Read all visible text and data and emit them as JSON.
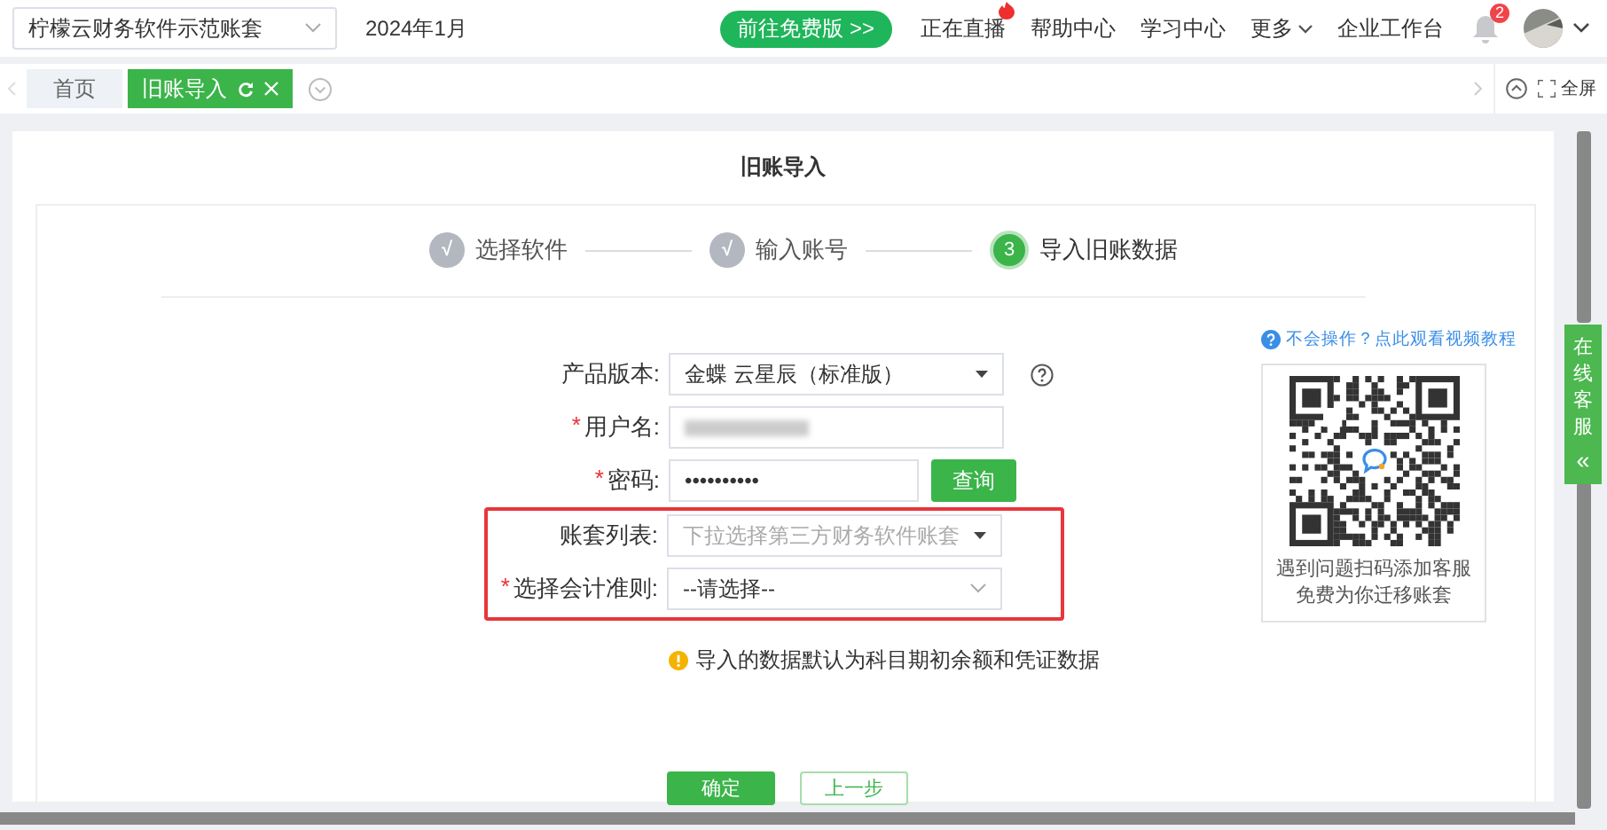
{
  "top_bar": {
    "account_selector": {
      "value": "柠檬云财务软件示范账套"
    },
    "period": "2024年1月",
    "promo_button": "前往免费版 >>",
    "nav_links": [
      {
        "label": "正在直播",
        "hot": true,
        "dropdown": false
      },
      {
        "label": "帮助中心",
        "hot": false,
        "dropdown": false
      },
      {
        "label": "学习中心",
        "hot": false,
        "dropdown": false
      },
      {
        "label": "更多",
        "hot": false,
        "dropdown": true
      },
      {
        "label": "企业工作台",
        "hot": false,
        "dropdown": false
      }
    ],
    "notifications": {
      "count": "2"
    }
  },
  "tab_bar": {
    "tabs": [
      {
        "label": "首页",
        "selected": false
      },
      {
        "label": "旧账导入",
        "selected": true
      }
    ],
    "fullscreen": "全屏"
  },
  "page": {
    "title": "旧账导入",
    "steps": [
      {
        "marker": "√",
        "label": "选择软件",
        "current": false
      },
      {
        "marker": "√",
        "label": "输入账号",
        "current": false
      },
      {
        "marker": "3",
        "label": "导入旧账数据",
        "current": true
      }
    ],
    "form": {
      "fields": [
        {
          "label": "产品版本:",
          "kind": "dropdown",
          "value": "金蝶 云星辰（标准版）",
          "help": true,
          "highlighted": false
        },
        {
          "label": "用户名:",
          "required_mark": "*",
          "kind": "text",
          "blurred": true,
          "highlighted": false
        },
        {
          "label": "密码:",
          "required_mark": "*",
          "kind": "password",
          "value": "••••••••••",
          "action": "查询",
          "highlighted": false
        },
        {
          "label": "账套列表:",
          "kind": "dropdown",
          "placeholder": "下拉选择第三方财务软件账套",
          "highlighted": true
        },
        {
          "label": "选择会计准则:",
          "required_mark": "*",
          "kind": "select",
          "value": "--请选择--",
          "highlighted": true
        }
      ],
      "hint": "导入的数据默认为科目期初余额和凭证数据",
      "buttons": [
        {
          "label": "确定",
          "kind": "primary"
        },
        {
          "label": "上一步",
          "kind": "secondary"
        }
      ]
    },
    "help": {
      "link": "不会操作？点此观看视频教程",
      "qr_caption": [
        "遇到问题扫码添加客服",
        "免费为你迁移账套"
      ]
    }
  },
  "chat_tab": {
    "label": "在线客服",
    "toggle": "«"
  }
}
